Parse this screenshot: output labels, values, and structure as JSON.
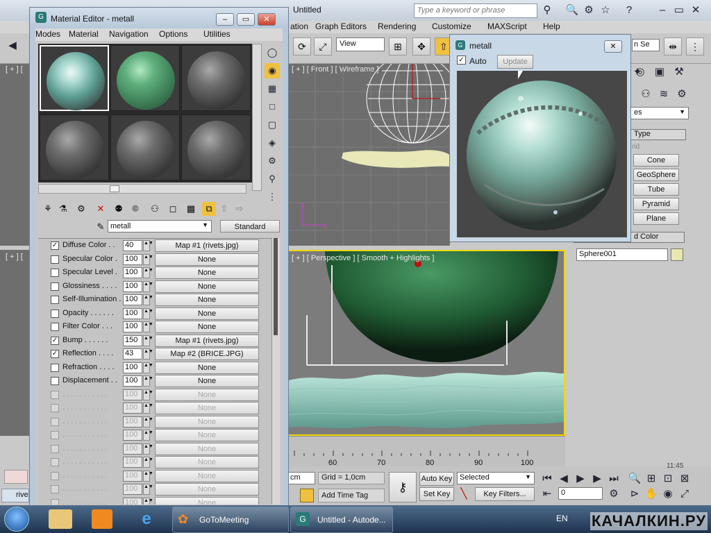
{
  "max": {
    "title": "Untitled",
    "search_placeholder": "Type a keyword or phrase",
    "menu": [
      "ation",
      "Graph Editors",
      "Rendering",
      "Customize",
      "MAXScript",
      "Help"
    ],
    "view_dropdown": "View",
    "front_label": "[ + ] [ Front ] [ Wireframe ]",
    "persp_label": "[ + ] [ Perspective ] [ Smooth + Highlights ]",
    "left_label1": "[ + ] [",
    "left_label2": "[ + ] [",
    "partial_field": "n Se"
  },
  "cmdpanel": {
    "dropdown": "es",
    "type_header": "Type",
    "grid_label": "rid",
    "buttons": [
      "Cone",
      "GeoSphere",
      "Tube",
      "Pyramid",
      "Plane"
    ],
    "color_header": "d Color",
    "object_name": "Sphere001"
  },
  "timeline": {
    "ticks": [
      "60",
      "70",
      "80",
      "90",
      "100"
    ]
  },
  "bottombar": {
    "unit": "cm",
    "grid": "Grid = 1,0cm",
    "add_time_tag": "Add Time Tag",
    "auto_key": "Auto Key",
    "set_key": "Set Key",
    "selected": "Selected",
    "key_filters": "Key Filters...",
    "frame": "0",
    "clock": "11:45"
  },
  "material_editor": {
    "title": "Material Editor - metall",
    "menu": [
      "Modes",
      "Material",
      "Navigation",
      "Options",
      "Utilities"
    ],
    "material_name": "metall",
    "material_type": "Standard",
    "maps": [
      {
        "enabled": true,
        "label": "Diffuse Color . .",
        "amount": "40",
        "map": "Map #1 (rivets.jpg)"
      },
      {
        "enabled": false,
        "label": "Specular Color  .",
        "amount": "100",
        "map": "None"
      },
      {
        "enabled": false,
        "label": "Specular Level  .",
        "amount": "100",
        "map": "None"
      },
      {
        "enabled": false,
        "label": "Glossiness  . . . .",
        "amount": "100",
        "map": "None"
      },
      {
        "enabled": false,
        "label": "Self-Illumination .",
        "amount": "100",
        "map": "None"
      },
      {
        "enabled": false,
        "label": "Opacity . . . . . .",
        "amount": "100",
        "map": "None"
      },
      {
        "enabled": false,
        "label": "Filter Color  . . .",
        "amount": "100",
        "map": "None"
      },
      {
        "enabled": true,
        "label": "Bump  . . . . . .",
        "amount": "150",
        "map": "Map #1 (rivets.jpg)"
      },
      {
        "enabled": true,
        "label": "Reflection  . . . .",
        "amount": "43",
        "map": "Map #2 (BRICE.JPG)"
      },
      {
        "enabled": false,
        "label": "Refraction  . . . .",
        "amount": "100",
        "map": "None"
      },
      {
        "enabled": false,
        "label": "Displacement  . .",
        "amount": "100",
        "map": "None"
      }
    ],
    "disabled_rows": 10,
    "disabled_label": ". . . . . . . . . . .",
    "disabled_amount": "100",
    "disabled_map": "None"
  },
  "preview": {
    "title": "metall",
    "auto_label": "Auto",
    "auto_checked": true,
    "update_label": "Update"
  },
  "taskbar": {
    "items": [
      "GoToMeeting",
      "Untitled - Autode..."
    ],
    "partial_task": "rive",
    "lang": "EN",
    "watermark": "КАЧАЛКИН.РУ"
  }
}
